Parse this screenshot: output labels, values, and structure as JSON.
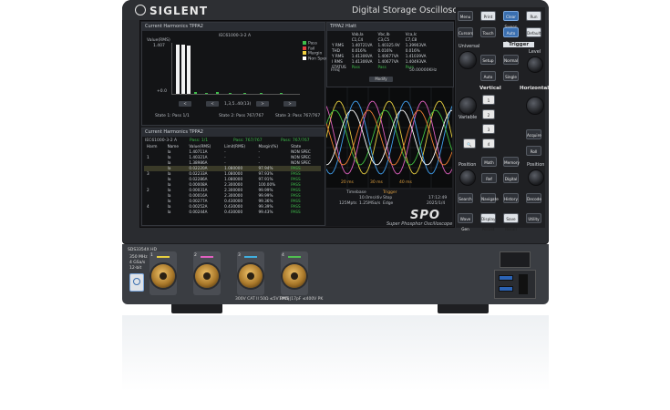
{
  "device": {
    "brand": "SIGLENT",
    "model_title": "Digital Storage Oscilloscope",
    "spo_logo": "SPO",
    "spo_subtitle": "Super Phosphor Oscilloscope",
    "side_label": "SDS3354X HD",
    "spec_lines": [
      "350 MHz",
      "4 GSa/s",
      "12-bit"
    ]
  },
  "screen": {
    "harmonics_panel": {
      "title": "Current Harmonics TPPA2",
      "standard": "IEC61000-3-2 A",
      "y_label": "Value(RMS)",
      "y_top": "1.407",
      "y_bottom": "+0.0",
      "x_label": "1,3,5..40(13)",
      "legend": [
        {
          "label": "Pass",
          "color": "#3fbf4b"
        },
        {
          "label": "Fail",
          "color": "#e04040"
        },
        {
          "label": "Margin",
          "color": "#f0d040"
        },
        {
          "label": "Non Spec",
          "color": "#ffffff"
        }
      ],
      "states": [
        "State 1: Pass 1/1",
        "State 2: Pass 767/767",
        "State 3: Pass 767/767"
      ]
    },
    "meas_panel": {
      "title": "TPPA2 Hlatt",
      "headers": [
        "",
        "Vab,Ia",
        "Vbc,Ib",
        "Vca,Ic"
      ],
      "subheaders": [
        "",
        "C1,C4",
        "C3,C5",
        "C7,C8"
      ],
      "rows": [
        [
          "Y RMS",
          "1.40721VA",
          "1.40325.9V",
          "1.39903VA"
        ],
        [
          "THD",
          "0.016%",
          "0.016%",
          "0.016%"
        ],
        [
          "Y RMS",
          "1.41306VA",
          "1.40677VA",
          "1.41039VA"
        ],
        [
          "I RMS",
          "1.41306VA",
          "1.40677VA",
          "1.40493VA"
        ],
        [
          "STATUS",
          "Pass",
          "Pass",
          "Pass"
        ]
      ],
      "freq_label": "Freq",
      "freq_value": "50.00000KHz",
      "modify_label": "Modify"
    },
    "harmonics_table": {
      "title": "Current Harmonics TPPA2",
      "status_tabs": [
        "IEC61000-3-2 A",
        "Pass: 1/1",
        "Pass: 767/767",
        "Pass: 767/767"
      ],
      "headers": [
        "Harm",
        "Name",
        "Value(RMS)",
        "Limit(RMS)",
        "Margin(%)",
        "State"
      ],
      "rows": [
        [
          "",
          "Ia",
          "1.40711A",
          "-",
          "-",
          "NON SPEC"
        ],
        [
          "1",
          "Ia",
          "1.40321A",
          "-",
          "-",
          "NON SPEC"
        ],
        [
          "",
          "Ia",
          "1.38986A",
          "-",
          "-",
          "NON SPEC"
        ],
        [
          "",
          "Ia",
          "0.02220A",
          "1.080000",
          "97.94%",
          "PASS"
        ],
        [
          "3",
          "Ia",
          "0.02233A",
          "1.080000",
          "97.93%",
          "PASS"
        ],
        [
          "",
          "Ia",
          "0.02286A",
          "1.080000",
          "97.91%",
          "PASS"
        ],
        [
          "",
          "Ia",
          "0.00008A",
          "2.300000",
          "100.00%",
          "PASS"
        ],
        [
          "2",
          "Ia",
          "0.00031A",
          "2.300000",
          "99.99%",
          "PASS"
        ],
        [
          "",
          "Ia",
          "0.00016A",
          "2.300000",
          "99.99%",
          "PASS"
        ],
        [
          "",
          "Ia",
          "0.00277A",
          "0.430000",
          "99.36%",
          "PASS"
        ],
        [
          "4",
          "Ia",
          "0.00252A",
          "0.430000",
          "99.39%",
          "PASS"
        ],
        [
          "",
          "Ia",
          "0.00244A",
          "0.430000",
          "99.43%",
          "PASS"
        ]
      ]
    },
    "waveform": {
      "time_labels": [
        "20 ms",
        "30 ms",
        "40 ms"
      ],
      "timebase_label": "Timebase",
      "timebase_value": "10.0ms/div",
      "trigger_label": "Trigger",
      "trigger_value": "Edge",
      "status": "Stop",
      "sample": "125Mpts",
      "rate": "1.25MSa/s",
      "time": "17:12:49",
      "date": "2025/1/4",
      "colors": [
        "#e8d040",
        "#e060c0",
        "#40a0f0",
        "#40c040",
        "#f08030",
        "#ffffff"
      ]
    }
  },
  "controls": {
    "top_buttons": [
      "Menu",
      "Print",
      "Clear Sweep",
      "Run Stop"
    ],
    "row2_buttons": [
      "Cursors",
      "Touch",
      "Auto Setup",
      "Default"
    ],
    "trigger_label": "Trigger",
    "universal_label": "Universal",
    "trigger_buttons": [
      "Setup",
      "Normal",
      "Auto",
      "Single"
    ],
    "level_label": "Level",
    "vertical_label": "Vertical",
    "horizontal_label": "Horizontal",
    "channel_buttons": [
      "1",
      "2",
      "3",
      "4"
    ],
    "vertical_buttons": [
      "Math",
      "Ref",
      "Digital",
      "Memory"
    ],
    "horizontal_buttons": [
      "Acquire",
      "Roll",
      "Zoom"
    ],
    "knob_labels": [
      "Variable",
      "Position",
      "Position"
    ],
    "bottom_buttons": [
      "Search",
      "Navigate",
      "History",
      "Decode"
    ],
    "bottom_row2": [
      "Wave Gen",
      "Display Persist",
      "Save Recall",
      "Utility"
    ]
  },
  "front": {
    "channels": [
      {
        "label": "1",
        "color": "#e8d040"
      },
      {
        "label": "2",
        "color": "#e060c0"
      },
      {
        "label": "3",
        "color": "#40b0e0"
      },
      {
        "label": "4",
        "color": "#50c050"
      }
    ],
    "safety_note": "300V CAT II 50Ω ≤5V RMS",
    "input_note": "1MΩ||17pF ≤400V PK"
  }
}
